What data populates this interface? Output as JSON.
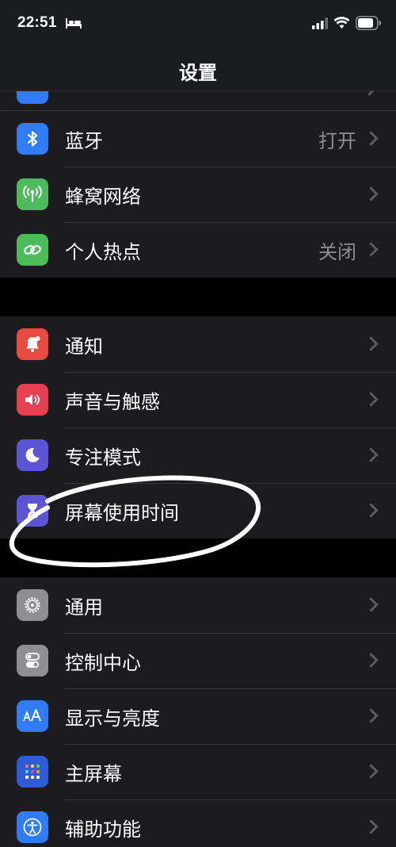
{
  "status_bar": {
    "time": "22:51",
    "icons": [
      "bed-icon",
      "cellular-signal-icon",
      "wifi-icon",
      "battery-icon"
    ]
  },
  "nav": {
    "title": "设置"
  },
  "colors": {
    "background": "#000000",
    "cell": "#1c1c1e",
    "separator": "#38383a",
    "secondary_text": "#8d8d92",
    "chevron": "#5a5a5e",
    "annotation": "#ffffff"
  },
  "group1": {
    "items": [
      {
        "label": "蓝牙",
        "value": "打开",
        "icon": "bluetooth-icon",
        "icon_color": "#2f7cf6"
      },
      {
        "label": "蜂窝网络",
        "value": "",
        "icon": "antenna-icon",
        "icon_color": "#4cbb5a"
      },
      {
        "label": "个人热点",
        "value": "关闭",
        "icon": "hotspot-icon",
        "icon_color": "#4cbb5a"
      }
    ]
  },
  "group2": {
    "items": [
      {
        "label": "通知",
        "icon": "bell-icon",
        "icon_color": "#e94a3f"
      },
      {
        "label": "声音与触感",
        "icon": "speaker-icon",
        "icon_color": "#e5404f"
      },
      {
        "label": "专注模式",
        "icon": "moon-icon",
        "icon_color": "#5b55d5"
      },
      {
        "label": "屏幕使用时间",
        "icon": "hourglass-icon",
        "icon_color": "#5b55d5"
      }
    ]
  },
  "group3": {
    "items": [
      {
        "label": "通用",
        "icon": "gear-icon",
        "icon_color": "#8e8e93"
      },
      {
        "label": "控制中心",
        "icon": "toggles-icon",
        "icon_color": "#8e8e93"
      },
      {
        "label": "显示与亮度",
        "icon": "text-size-icon",
        "icon_color": "#2f7cf6"
      },
      {
        "label": "主屏幕",
        "icon": "app-grid-icon",
        "icon_color": "#2e5cd6"
      },
      {
        "label": "辅助功能",
        "icon": "accessibility-icon",
        "icon_color": "#2f7cf6"
      }
    ]
  }
}
